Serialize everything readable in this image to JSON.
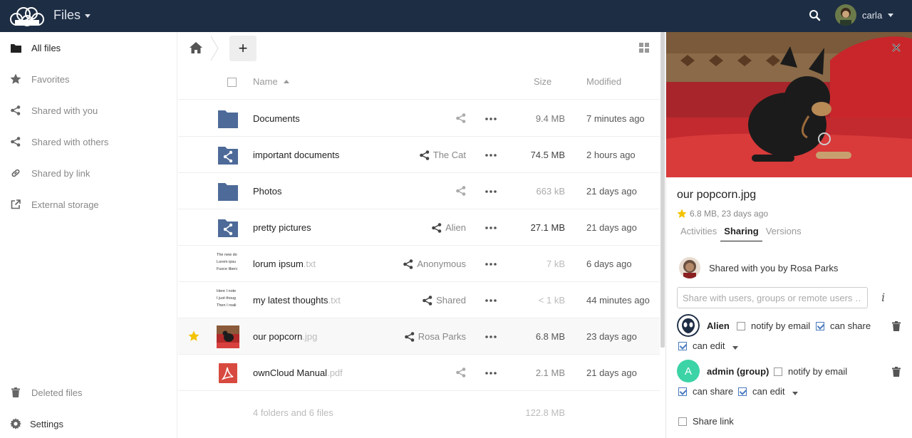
{
  "header": {
    "app_name": "Files",
    "user_name": "carla"
  },
  "sidebar": {
    "items": [
      {
        "label": "All files",
        "icon": "folder-icon",
        "active": true
      },
      {
        "label": "Favorites",
        "icon": "star-icon"
      },
      {
        "label": "Shared with you",
        "icon": "share-icon"
      },
      {
        "label": "Shared with others",
        "icon": "share-icon"
      },
      {
        "label": "Shared by link",
        "icon": "link-icon"
      },
      {
        "label": "External storage",
        "icon": "external-icon"
      }
    ],
    "deleted_files": "Deleted files",
    "settings": "Settings"
  },
  "files": {
    "columns": {
      "name": "Name",
      "size": "Size",
      "modified": "Modified"
    },
    "rows": [
      {
        "name": "Documents",
        "ext": "",
        "share": "",
        "size": "9.4 MB",
        "modified": "7 minutes ago",
        "type": "folder"
      },
      {
        "name": "important documents",
        "ext": "",
        "share": "The Cat",
        "size": "74.5 MB",
        "modified": "2 hours ago",
        "type": "shared-folder"
      },
      {
        "name": "Photos",
        "ext": "",
        "share": "",
        "size": "663 kB",
        "modified": "21 days ago",
        "type": "folder"
      },
      {
        "name": "pretty pictures",
        "ext": "",
        "share": "Alien",
        "size": "27.1 MB",
        "modified": "21 days ago",
        "type": "shared-folder"
      },
      {
        "name": "lorum ipsum",
        "ext": ".txt",
        "share": "Anonymous",
        "size": "7 kB",
        "modified": "6 days ago",
        "type": "text",
        "thumb_lines": [
          "The new do",
          "Lorem ipsu",
          "Fusce liberc"
        ]
      },
      {
        "name": "my latest thoughts",
        "ext": ".txt",
        "share": "Shared",
        "size": "< 1 kB",
        "modified": "44 minutes ago",
        "type": "text",
        "thumb_lines": [
          "Here I note",
          "I just thoug",
          "Then I reali"
        ]
      },
      {
        "name": "our popcorn",
        "ext": ".jpg",
        "share": "Rosa Parks",
        "size": "6.8 MB",
        "modified": "23 days ago",
        "type": "image",
        "favorite": true,
        "selected": true
      },
      {
        "name": "ownCloud Manual",
        "ext": ".pdf",
        "share": "",
        "size": "2.1 MB",
        "modified": "21 days ago",
        "type": "pdf"
      }
    ],
    "summary": {
      "count": "4 folders and 6 files",
      "total": "122.8 MB"
    }
  },
  "details": {
    "title": "our popcorn.jpg",
    "meta": "6.8 MB, 23 days ago",
    "tabs": [
      "Activities",
      "Sharing",
      "Versions"
    ],
    "active_tab": "Sharing",
    "shared_by": "Shared with you by Rosa Parks",
    "share_placeholder": "Share with users, groups or remote users …",
    "shares": [
      {
        "name": "Alien",
        "notify_label": "notify by email",
        "notify": false,
        "can_share_label": "can share",
        "can_share": true,
        "can_edit_label": "can edit",
        "can_edit": true
      },
      {
        "name": "admin (group)",
        "avatar_letter": "A",
        "notify_label": "notify by email",
        "notify": false,
        "can_share_label": "can share",
        "can_share": true,
        "can_edit_label": "can edit",
        "can_edit": true
      }
    ],
    "share_link": "Share link"
  },
  "colors": {
    "header_bg": "#1d2d44",
    "folder": "#4d6a98",
    "accent": "#4a7abf",
    "admin_avatar": "#3cd3a6",
    "pdf": "#d84a3f",
    "star": "#f3c300"
  }
}
